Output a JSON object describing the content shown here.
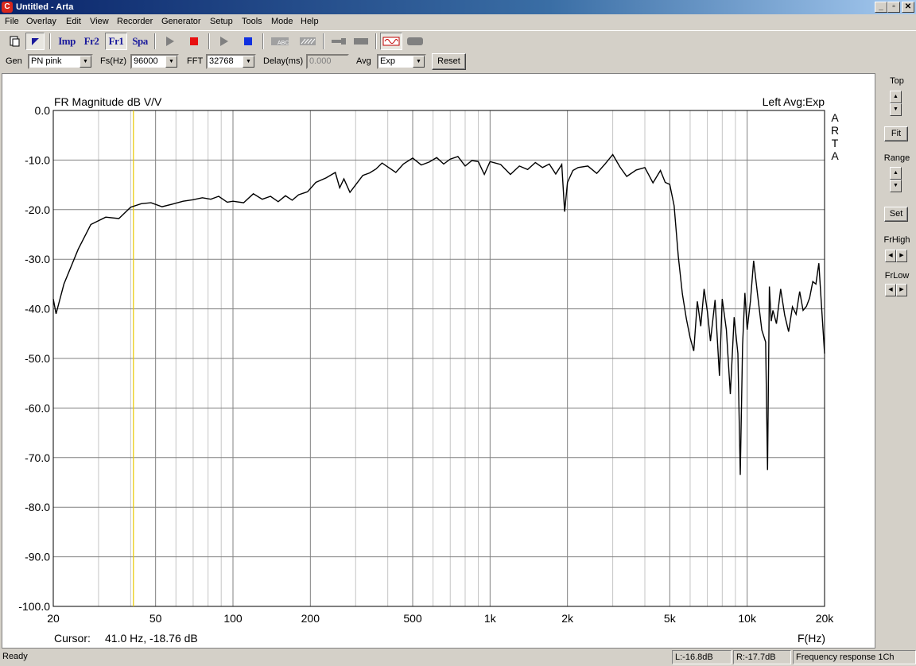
{
  "window": {
    "title": "Untitled - Arta",
    "app_icon": "arta-icon"
  },
  "menu": [
    "File",
    "Overlay",
    "Edit",
    "View",
    "Recorder",
    "Generator",
    "Setup",
    "Tools",
    "Mode",
    "Help"
  ],
  "toolbar": {
    "imp": "Imp",
    "fr2": "Fr2",
    "fr1": "Fr1",
    "spa": "Spa",
    "icons": [
      "new-file-icon",
      "cursor-mode-icon",
      "play-icon",
      "stop-icon",
      "play-icon",
      "stop-icon",
      "abc-icon",
      "calibrate-icon",
      "probe-icon",
      "meter-icon",
      "generator-wave-icon",
      "level-icon"
    ],
    "colors": {
      "stop": "#e81010",
      "stop_blue": "#1030e0",
      "play": "#808080",
      "wave": "#c00000"
    }
  },
  "controls": {
    "gen_label": "Gen",
    "gen_value": "PN pink",
    "fs_label": "Fs(Hz)",
    "fs_value": "96000",
    "fft_label": "FFT",
    "fft_value": "32768",
    "delay_label": "Delay(ms)",
    "delay_value": "0.000",
    "avg_label": "Avg",
    "avg_value": "Exp",
    "reset_label": "Reset"
  },
  "plot": {
    "title": "FR Magnitude dB V/V",
    "channel_info": "Left  Avg:Exp",
    "watermark": "ARTA",
    "cursor_label": "Cursor:",
    "cursor_value": "41.0 Hz, -18.76 dB",
    "xunit": "F(Hz)",
    "cursor_color": "#e8c800"
  },
  "side": {
    "top_label": "Top",
    "fit_label": "Fit",
    "range_label": "Range",
    "set_label": "Set",
    "frhigh_label": "FrHigh",
    "frlow_label": "FrLow"
  },
  "status": {
    "ready": "Ready",
    "left_level": "L:-16.8dB",
    "right_level": "R:-17.7dB",
    "mode": "Frequency response 1Ch"
  },
  "chart_data": {
    "type": "line",
    "title": "FR Magnitude dB V/V",
    "xlabel": "F(Hz)",
    "ylabel": "",
    "xscale": "log",
    "xlim": [
      20,
      20000
    ],
    "ylim": [
      -100,
      0
    ],
    "grid": true,
    "x_ticks": [
      "20",
      "50",
      "100",
      "200",
      "500",
      "1k",
      "2k",
      "5k",
      "10k",
      "20k"
    ],
    "y_ticks": [
      "0.0",
      "-10.0",
      "-20.0",
      "-30.0",
      "-40.0",
      "-50.0",
      "-60.0",
      "-70.0",
      "-80.0",
      "-90.0",
      "-100.0"
    ],
    "cursor_x": 41.0,
    "series": [
      {
        "x": [
          20,
          20.5,
          22,
          25,
          28,
          32,
          36,
          40,
          44,
          48,
          53,
          58,
          64,
          70,
          76,
          82,
          88,
          95,
          100,
          110,
          120,
          130,
          140,
          150,
          160,
          170,
          180,
          195,
          210,
          230,
          250,
          260,
          270,
          285,
          300,
          320,
          340,
          360,
          380,
          400,
          430,
          460,
          500,
          540,
          580,
          620,
          660,
          700,
          750,
          800,
          850,
          900,
          950,
          1000,
          1100,
          1200,
          1300,
          1400,
          1500,
          1600,
          1700,
          1800,
          1900,
          1950,
          2000,
          2100,
          2200,
          2400,
          2600,
          2800,
          3000,
          3200,
          3400,
          3700,
          4000,
          4300,
          4600,
          4800,
          5000,
          5200,
          5400,
          5600,
          5800,
          6000,
          6200,
          6400,
          6600,
          6800,
          7000,
          7200,
          7500,
          7800,
          8000,
          8300,
          8600,
          8900,
          9200,
          9400,
          9600,
          9800,
          10000,
          10300,
          10600,
          11000,
          11400,
          11800,
          12000,
          12200,
          12400,
          12600,
          13000,
          13500,
          14000,
          14500,
          15000,
          15500,
          16000,
          16500,
          17000,
          17500,
          18000,
          18500,
          19000,
          19500,
          20000
        ],
        "y": [
          -38,
          -41,
          -35,
          -28,
          -23,
          -21.5,
          -21.8,
          -19.5,
          -18.8,
          -18.6,
          -19.4,
          -18.9,
          -18.3,
          -18.0,
          -17.6,
          -17.9,
          -17.3,
          -18.5,
          -18.3,
          -18.6,
          -16.8,
          -17.9,
          -17.3,
          -18.4,
          -17.2,
          -18.1,
          -17.0,
          -16.4,
          -14.5,
          -13.6,
          -12.5,
          -15.6,
          -13.8,
          -16.5,
          -15.0,
          -13.1,
          -12.6,
          -11.8,
          -10.6,
          -11.4,
          -12.5,
          -10.8,
          -9.6,
          -11.0,
          -10.4,
          -9.5,
          -10.8,
          -9.8,
          -9.3,
          -11.2,
          -10.1,
          -10.3,
          -12.9,
          -10.3,
          -10.9,
          -12.9,
          -11.2,
          -11.9,
          -10.5,
          -11.5,
          -10.8,
          -12.8,
          -10.9,
          -20.4,
          -14.5,
          -12.1,
          -11.5,
          -11.2,
          -12.7,
          -10.8,
          -8.9,
          -11.4,
          -13.3,
          -12.0,
          -11.5,
          -14.6,
          -12.1,
          -14.5,
          -14.9,
          -19.2,
          -29.5,
          -37.0,
          -42.0,
          -45.8,
          -48.5,
          -38.5,
          -43.5,
          -36.0,
          -40.5,
          -46.5,
          -38.2,
          -53.5,
          -38.0,
          -44.2,
          -57.2,
          -41.7,
          -49.0,
          -73.5,
          -47.3,
          -36.8,
          -44.2,
          -38.4,
          -30.3,
          -37.6,
          -44.3,
          -46.7,
          -72.5,
          -35.5,
          -42.5,
          -40.3,
          -43.0,
          -36.0,
          -41.3,
          -44.6,
          -39.6,
          -41.1,
          -36.5,
          -40.3,
          -39.5,
          -37.8,
          -34.5,
          -35.0,
          -30.8,
          -40.0,
          -49.0
        ]
      }
    ]
  }
}
